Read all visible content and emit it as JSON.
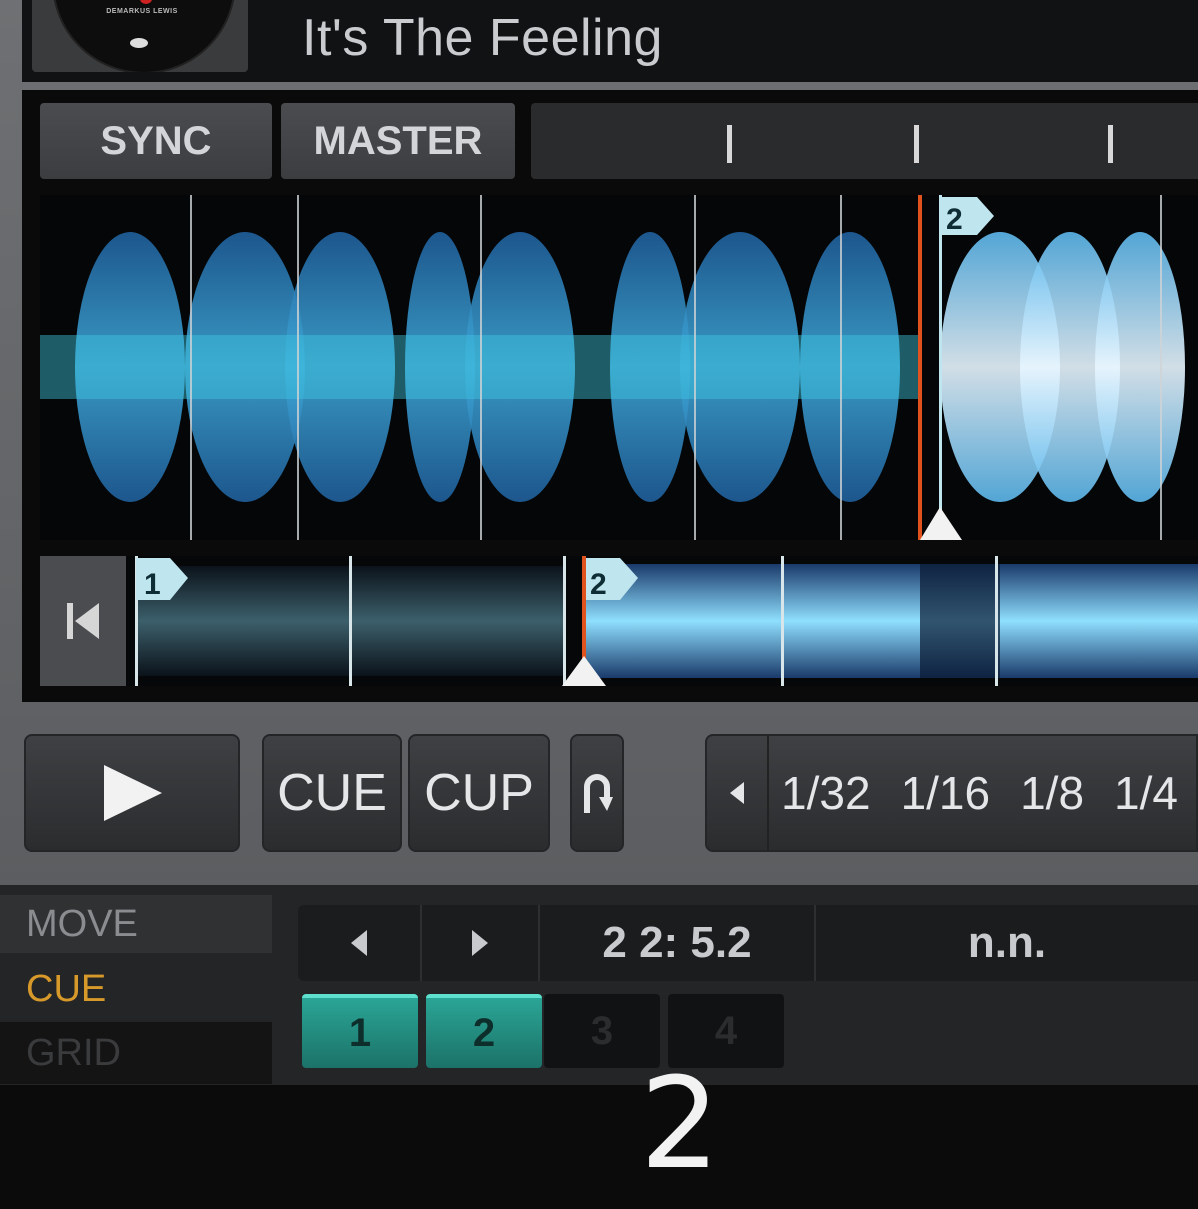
{
  "header": {
    "track_title": "It's The Feeling",
    "cover_label": "DEMARKUS LEWIS"
  },
  "deck": {
    "sync_label": "SYNC",
    "master_label": "MASTER"
  },
  "waveform": {
    "cue_marker_label": "2",
    "accent_color": "#4fd6ea",
    "playhead_color": "#e0531f"
  },
  "overview": {
    "cue_markers": [
      "1",
      "2"
    ]
  },
  "transport": {
    "cue_label": "CUE",
    "cup_label": "CUP",
    "loop_icon": "loop-icon",
    "loop_sizes": [
      "1/32",
      "1/16",
      "1/8",
      "1/4"
    ]
  },
  "modes": {
    "items": [
      "MOVE",
      "CUE",
      "GRID"
    ],
    "active": "CUE",
    "active_color": "#d79a2a"
  },
  "cue_nav": {
    "position": "2  2: 5.2",
    "name": "n.n."
  },
  "hot_cues": {
    "items": [
      "1",
      "2",
      "3",
      "4"
    ],
    "set": [
      "1",
      "2"
    ],
    "set_color": "#2aa596"
  },
  "caption": "2"
}
